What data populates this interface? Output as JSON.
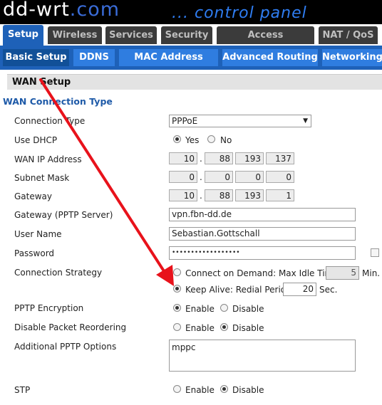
{
  "header": {
    "logo_main": "dd-wrt",
    "logo_suffix": ".com",
    "subtitle": "... control panel"
  },
  "tabs": [
    {
      "label": "Setup",
      "active": true
    },
    {
      "label": "Wireless"
    },
    {
      "label": "Services"
    },
    {
      "label": "Security"
    },
    {
      "label": "Access Restrictions"
    },
    {
      "label": "NAT / QoS"
    }
  ],
  "subtabs": [
    {
      "label": "Basic Setup",
      "active": true
    },
    {
      "label": "DDNS"
    },
    {
      "label": "MAC Address Clone"
    },
    {
      "label": "Advanced Routing"
    },
    {
      "label": "Networking"
    }
  ],
  "section": {
    "title": "WAN Setup",
    "legend": "WAN Connection Type"
  },
  "fields": {
    "connection_type": {
      "label": "Connection Type",
      "value": "PPPoE"
    },
    "use_dhcp": {
      "label": "Use DHCP",
      "yes": "Yes",
      "no": "No",
      "selected": "Yes"
    },
    "wan_ip": {
      "label": "WAN IP Address",
      "octets": [
        "10",
        "88",
        "193",
        "137"
      ]
    },
    "subnet_mask": {
      "label": "Subnet Mask",
      "octets": [
        "0",
        "0",
        "0",
        "0"
      ]
    },
    "gateway": {
      "label": "Gateway",
      "octets": [
        "10",
        "88",
        "193",
        "1"
      ]
    },
    "pptp_server": {
      "label": "Gateway (PPTP Server)",
      "value": "vpn.fbn-dd.de"
    },
    "user_name": {
      "label": "User Name",
      "value": "Sebastian.Gottschall"
    },
    "password": {
      "label": "Password",
      "value": "••••••••••••••••••"
    },
    "connection_strategy": {
      "label": "Connection Strategy",
      "demand_label": "Connect on Demand: Max Idle Time",
      "demand_value": "5",
      "demand_unit": "Min.",
      "keepalive_label": "Keep Alive: Redial Period",
      "keepalive_value": "20",
      "keepalive_unit": "Sec.",
      "selected": "Keep Alive"
    },
    "pptp_encryption": {
      "label": "PPTP Encryption",
      "enable": "Enable",
      "disable": "Disable",
      "selected": "Enable"
    },
    "packet_reordering": {
      "label": "Disable Packet Reordering",
      "enable": "Enable",
      "disable": "Disable",
      "selected": "Disable"
    },
    "pptp_options": {
      "label": "Additional PPTP Options",
      "value": "mppc"
    },
    "stp": {
      "label": "STP",
      "enable": "Enable",
      "disable": "Disable",
      "selected": "Disable"
    }
  },
  "colors": {
    "accent": "#1e61b8",
    "annotation_arrow": "#e8121b"
  }
}
